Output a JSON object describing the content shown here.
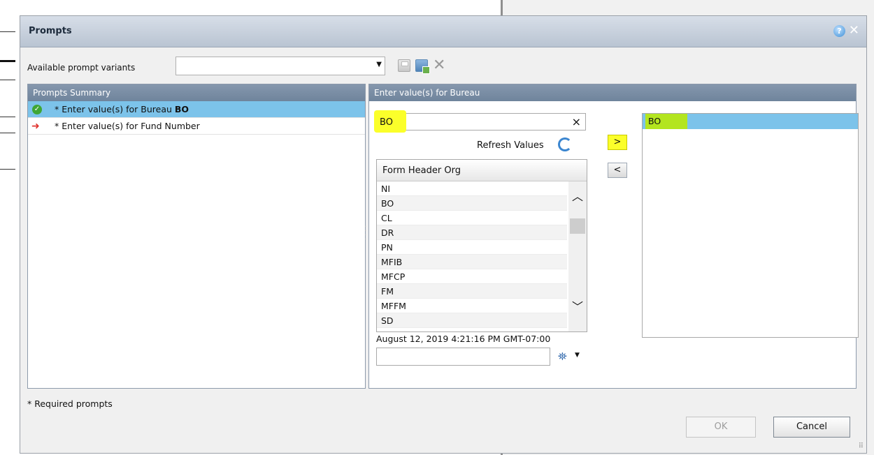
{
  "dialog": {
    "title": "Prompts",
    "help_icon": "question-icon",
    "close_icon": "close-icon"
  },
  "variants": {
    "label": "Available prompt variants",
    "value": ""
  },
  "summary": {
    "header": "Prompts Summary",
    "rows": [
      {
        "text": "* Enter value(s) for Bureau ",
        "value": "BO",
        "icon": "check-circle-icon",
        "selected": true
      },
      {
        "text": "* Enter value(s) for Fund Number",
        "value": "",
        "icon": "red-arrow-icon",
        "selected": false
      }
    ]
  },
  "entry": {
    "header": "Enter value(s) for Bureau",
    "search_value": "BO",
    "clear_glyph": "×",
    "refresh_label": "Refresh Values",
    "list_header": "Form Header Org",
    "list_items": [
      "NI",
      "BO",
      "CL",
      "DR",
      "PN",
      "MFIB",
      "MFCP",
      "FM",
      "MFFM",
      "SD"
    ],
    "timestamp": "August 12, 2019 4:21:16 PM GMT-07:00",
    "add_label": ">",
    "remove_label": "<",
    "selected_items": [
      "BO"
    ]
  },
  "footer": {
    "required_note": "* Required prompts",
    "ok_label": "OK",
    "cancel_label": "Cancel"
  },
  "colors": {
    "header_bg": "#7a8da4",
    "selected_row": "#7cc3ea",
    "highlight_yellow": "#fbff2a",
    "highlight_green": "#b3e51f"
  }
}
